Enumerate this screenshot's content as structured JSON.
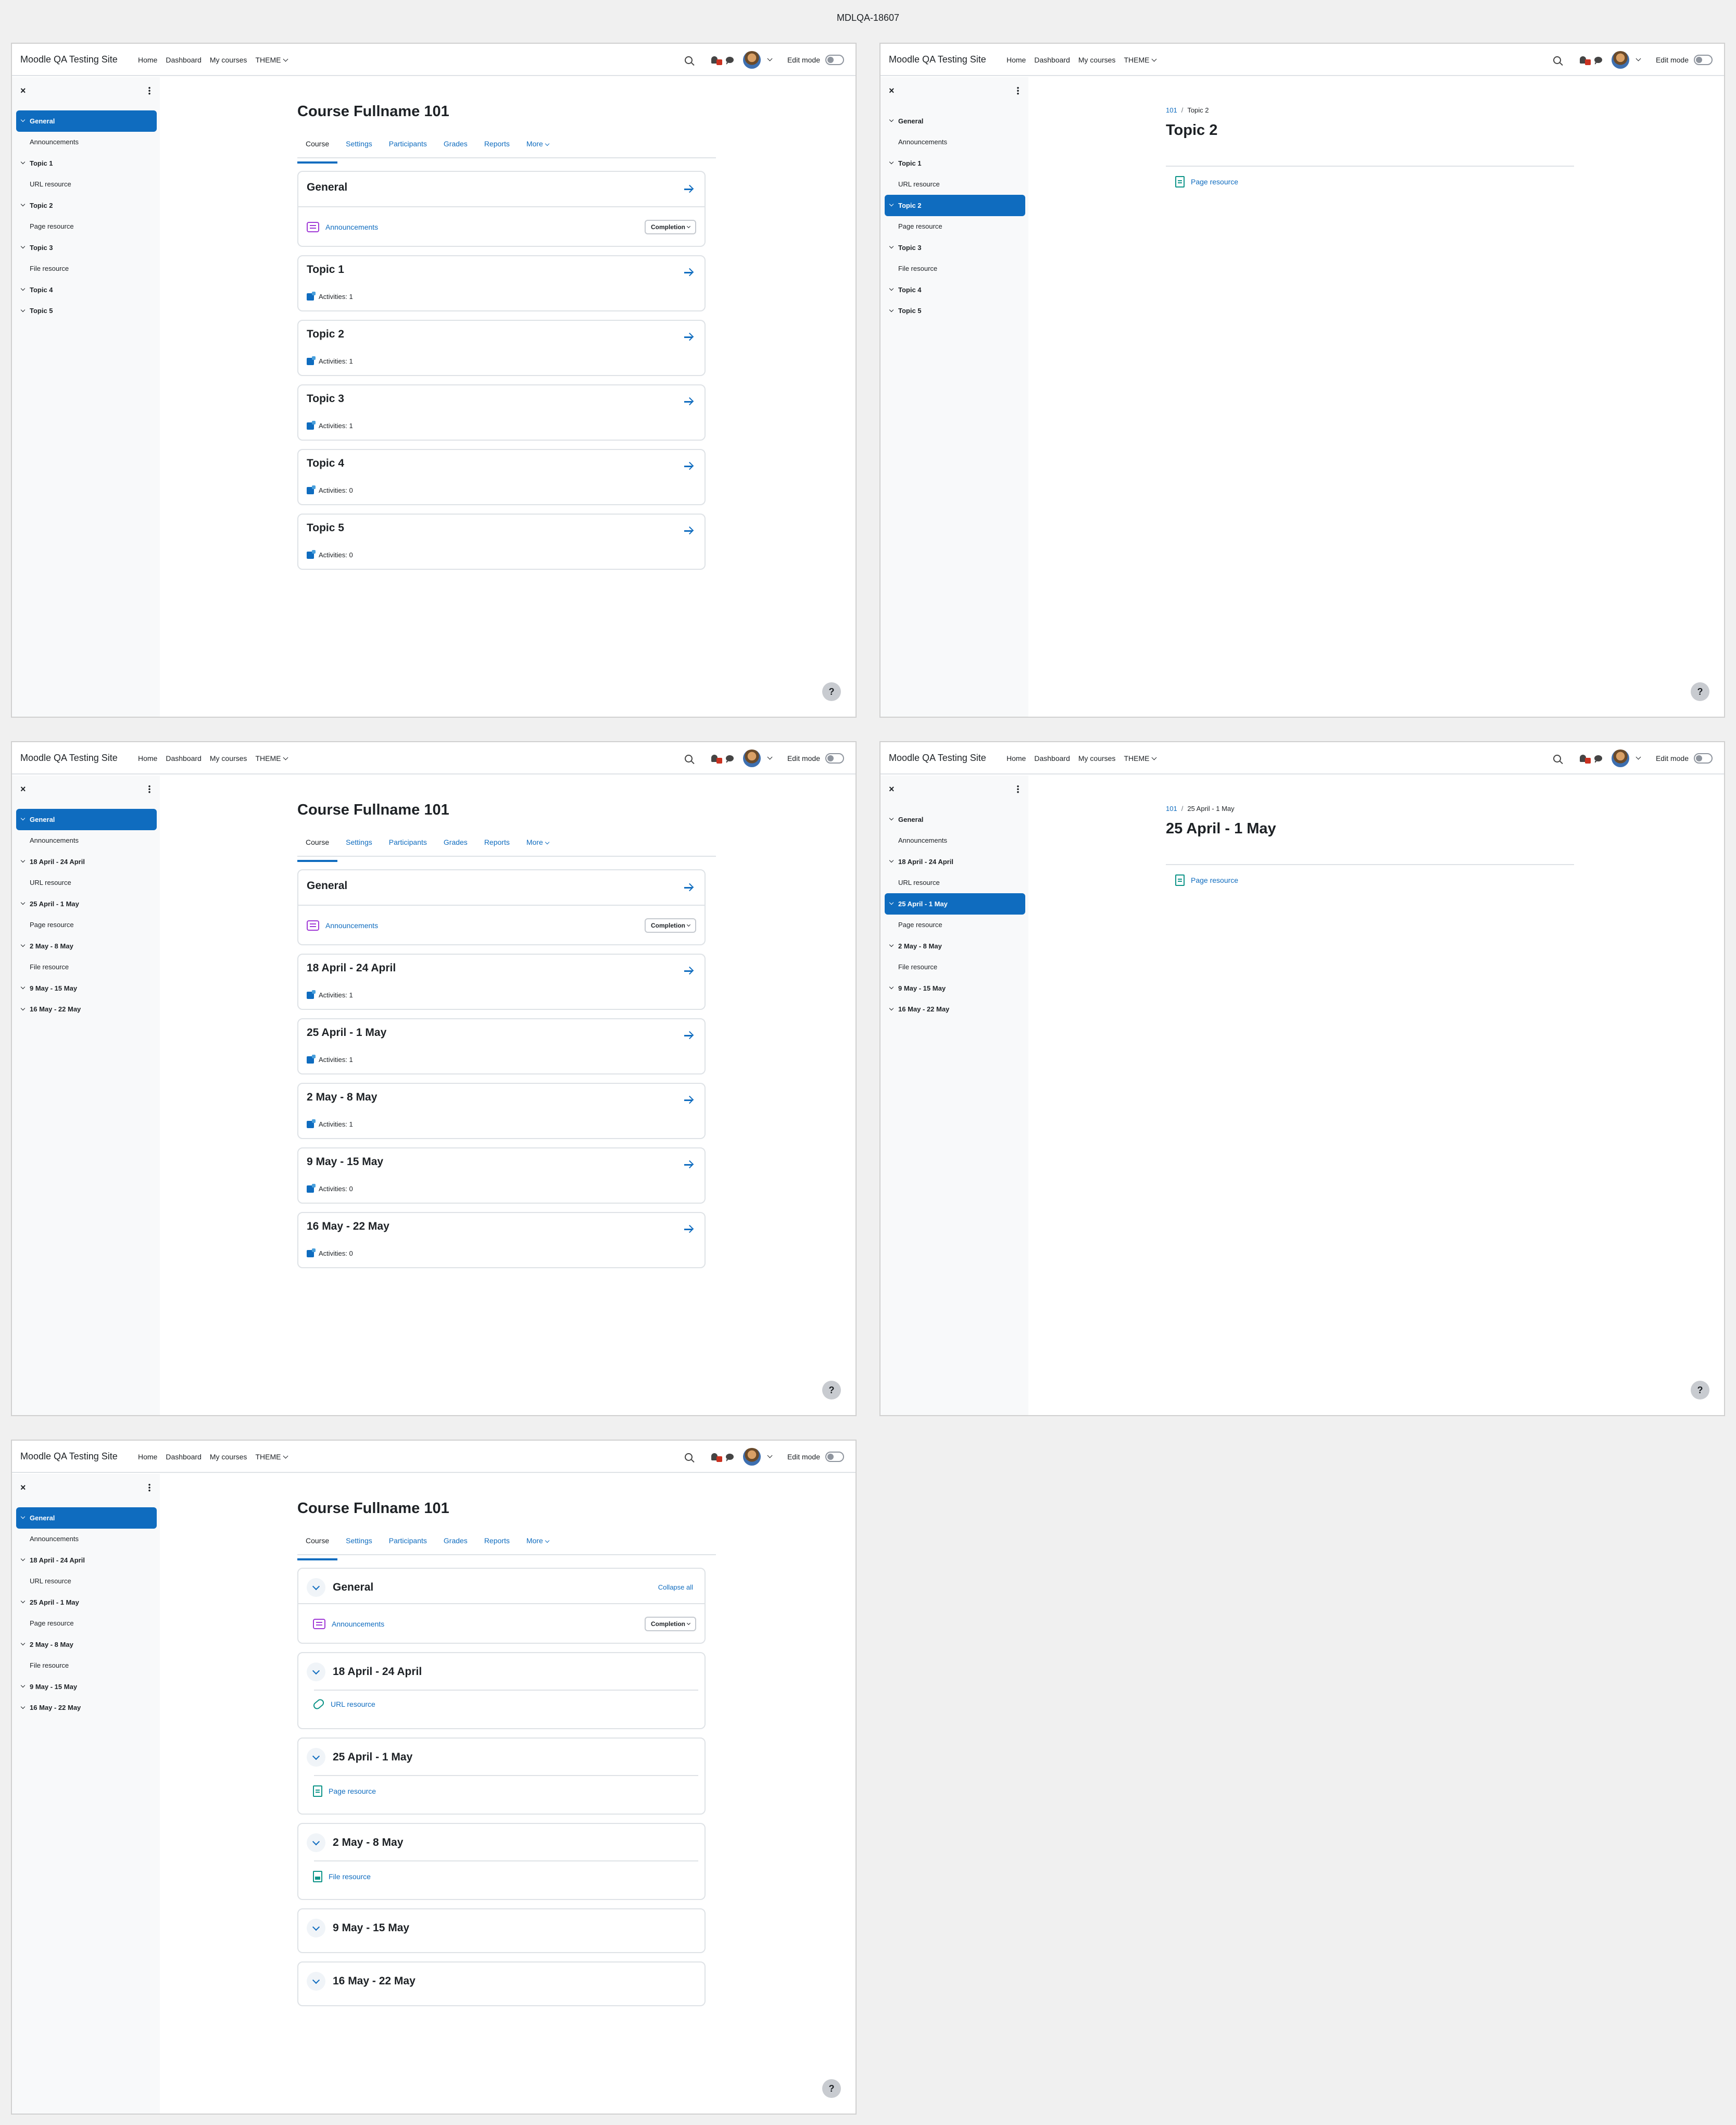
{
  "caption": "MDLQA-18607",
  "site": {
    "name": "Moodle QA Testing Site",
    "nav": [
      "Home",
      "Dashboard",
      "My courses",
      "THEME"
    ],
    "edit_mode": "Edit mode",
    "help": "?"
  },
  "drawer": {
    "close": "×"
  },
  "course": {
    "title": "Course Fullname 101",
    "tabs": [
      "Course",
      "Settings",
      "Participants",
      "Grades",
      "Reports",
      "More"
    ],
    "general": {
      "title": "General",
      "activity": "Announcements",
      "completion": "Completion",
      "collapse_all": "Collapse all"
    }
  },
  "topics": {
    "index": [
      "General",
      "Announcements",
      "Topic 1",
      "URL resource",
      "Topic 2",
      "Page resource",
      "Topic 3",
      "File resource",
      "Topic 4",
      "Topic 5"
    ],
    "sections": [
      {
        "title": "Topic 1",
        "activities": "Activities: 1"
      },
      {
        "title": "Topic 2",
        "activities": "Activities: 1"
      },
      {
        "title": "Topic 3",
        "activities": "Activities: 1"
      },
      {
        "title": "Topic 4",
        "activities": "Activities: 0"
      },
      {
        "title": "Topic 5",
        "activities": "Activities: 0"
      }
    ]
  },
  "weeks": {
    "index": [
      "General",
      "Announcements",
      "18 April - 24 April",
      "URL resource",
      "25 April - 1 May",
      "Page resource",
      "2 May - 8 May",
      "File resource",
      "9 May - 15 May",
      "16 May - 22 May"
    ],
    "sections": [
      {
        "title": "18 April - 24 April",
        "activities": "Activities: 1",
        "resource": "URL resource"
      },
      {
        "title": "25 April - 1 May",
        "activities": "Activities: 1",
        "resource": "Page resource"
      },
      {
        "title": "2 May - 8 May",
        "activities": "Activities: 1",
        "resource": "File resource"
      },
      {
        "title": "9 May - 15 May",
        "activities": "Activities: 0"
      },
      {
        "title": "16 May - 22 May",
        "activities": "Activities: 0"
      }
    ]
  },
  "single_topic": {
    "crumb_course": "101",
    "crumb_sep": "/",
    "title": "Topic 2",
    "resource": "Page resource"
  },
  "single_week": {
    "crumb_course": "101",
    "crumb_sep": "/",
    "title": "25 April - 1 May",
    "resource": "Page resource"
  }
}
